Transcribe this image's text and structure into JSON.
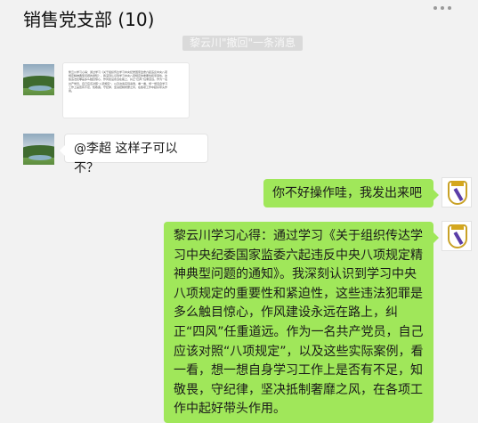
{
  "header": {
    "title": "销售党支部 (10)",
    "more_icon": "more-dots-icon"
  },
  "system_message": "黎云川\"撤回\"一条消息",
  "messages": [
    {
      "side": "left",
      "type": "image",
      "thumbnail_text": "黎云川学习心得：通过学习《关于组织传达学习中央纪委国家监委六起违反中央八项规定精神典型问题的通知》，我深刻认识到学习中央八项规定的重要性和紧迫性，这些违法犯罪是多么触目惊心，作风建设永远在路上，纠正“四风”任重道远。作为一名共产党员，自己应该对照“八项规定”，以及这些实际案例，看一看，想一想自身学习工作上是否有不足，知敬畏，守纪律，坚决抵制奢靡之风，在各项工作中起好带头作用。"
    },
    {
      "side": "left",
      "type": "text",
      "text": "@李超 这样子可以不？"
    },
    {
      "side": "right",
      "type": "text",
      "text": "你不好操作哇，我发出来吧"
    },
    {
      "side": "right",
      "type": "text",
      "text": "黎云川学习心得：通过学习《关于组织传达学习中央纪委国家监委六起违反中央八项规定精神典型问题的通知》。我深刻认识到学习中央八项规定的重要性和紧迫性，这些违法犯罪是多么触目惊心，作风建设永远在路上，纠正“四风”任重道远。作为一名共产党员，自己应该对照“八项规定”，以及这些实际案例，看一看，想一想自身学习工作上是否有不足，知敬畏，守纪律，坚决抵制奢靡之风，在各项工作中起好带头作用。"
    }
  ],
  "colors": {
    "background": "#f2f2f2",
    "sent_bubble": "#a0e75a",
    "received_bubble": "#ffffff"
  },
  "avatars": {
    "left": "landscape-avatar",
    "right": "real-madrid-crest-avatar"
  }
}
